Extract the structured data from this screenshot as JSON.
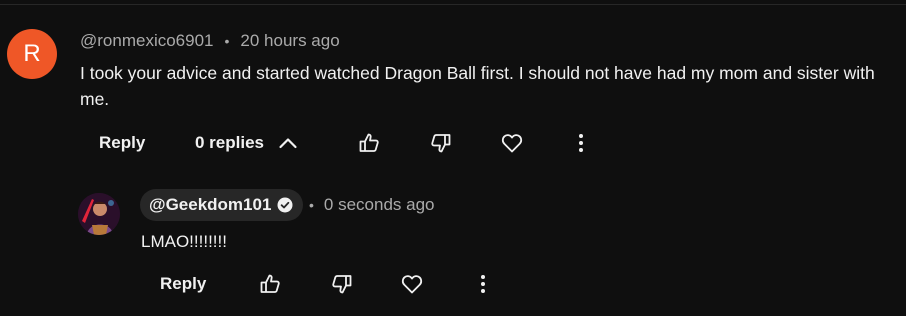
{
  "comment": {
    "avatar_letter": "R",
    "avatar_color": "#ef5727",
    "author": "@ronmexico6901",
    "separator": "•",
    "time": "20 hours ago",
    "text": "I took your advice and started watched Dragon Ball first. I should not have had my mom and sister with me.",
    "actions": {
      "reply_label": "Reply",
      "replies_label": "0 replies",
      "replies_icon": "chevron-up-icon",
      "like_icon": "thumbs-up-icon",
      "dislike_icon": "thumbs-down-icon",
      "heart_icon": "heart-icon",
      "more_icon": "more-vertical-icon"
    }
  },
  "reply": {
    "author": "@Geekdom101",
    "verified_icon": "verified-check-icon",
    "separator": "•",
    "time": "0 seconds ago",
    "text": "LMAO!!!!!!!!",
    "actions": {
      "reply_label": "Reply",
      "like_icon": "thumbs-up-icon",
      "dislike_icon": "thumbs-down-icon",
      "heart_icon": "heart-icon",
      "more_icon": "more-vertical-icon"
    }
  },
  "theme": {
    "background": "#0f0f0f",
    "text_primary": "#f1f1f1",
    "text_secondary": "#aaaaaa",
    "chip_background": "#272727"
  }
}
